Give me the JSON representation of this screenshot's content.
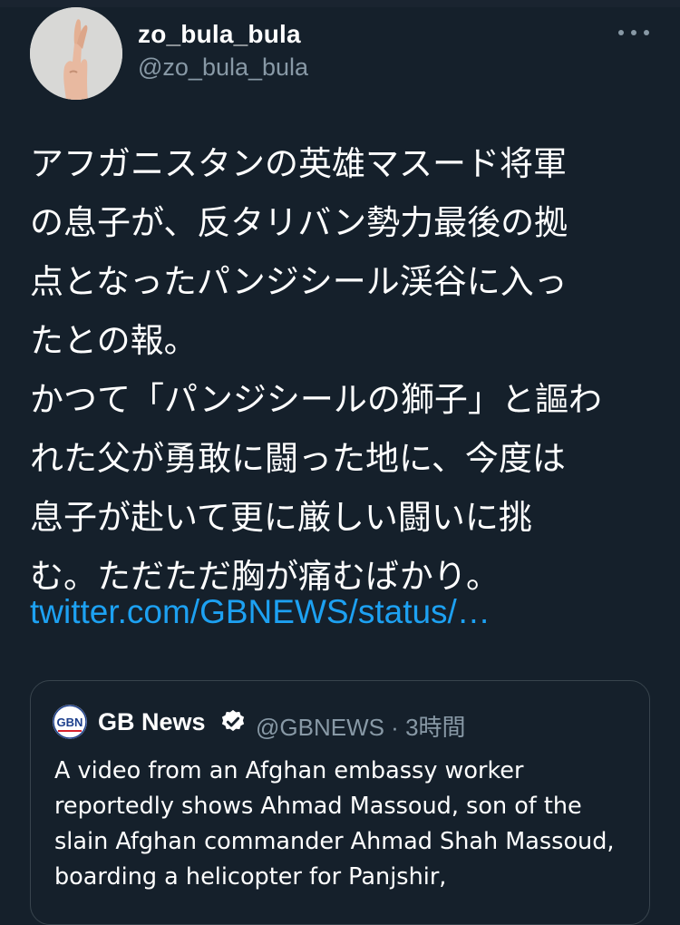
{
  "tweet": {
    "author_name": "zo_bula_bula",
    "author_handle": "@zo_bula_bula",
    "text": "アフガニスタンの英雄マスード将軍\nの息子が、反タリバン勢力最後の拠\n点となったパンジシール渓谷に入っ\nたとの報。\nかつて「パンジシールの獅子」と謳わ\nれた父が勇敢に闘った地に、今度は\n息子が赴いて更に厳しい闘いに挑\nむ。ただただ胸が痛むばかり。",
    "link": "twitter.com/GBNEWS/status/…",
    "avatar_icon": "crossed-fingers-hand",
    "link_color": "#1da1f2"
  },
  "quoted_tweet": {
    "logo_text": "GBN",
    "author_name": "GB News",
    "verified_icon": "verified-badge-icon",
    "handle_time": "@GBNEWS · 3時間",
    "text": "A video from an Afghan embassy worker reportedly shows Ahmad Massoud, son of the slain Afghan commander Ahmad Shah Massoud, boarding a helicopter for Panjshir,"
  },
  "theme": {
    "background": "#15202b",
    "secondary_text": "#8899a6",
    "border": "#38444d"
  }
}
